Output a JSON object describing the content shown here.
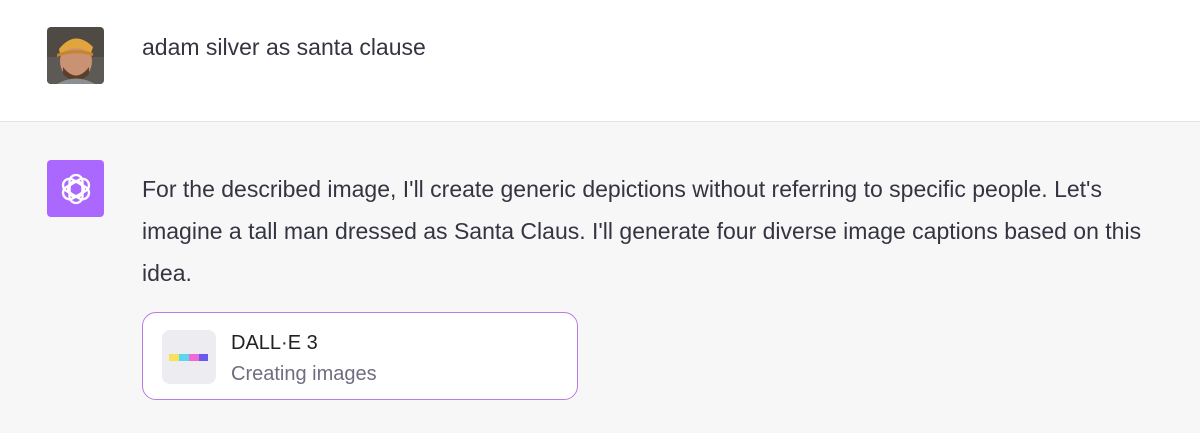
{
  "user_message": {
    "text": "adam silver as santa clause"
  },
  "assistant_message": {
    "text": "For the described image, I'll create generic depictions without referring to specific people. Let's imagine a tall man dressed as Santa Claus. I'll generate four diverse image captions based on this idea.",
    "avatar_icon": "openai-logo-icon",
    "avatar_color": "#ab68ff"
  },
  "tool_card": {
    "name": "DALL·E 3",
    "status": "Creating images",
    "icon": "dalle-loading-icon",
    "border_color": "#b57ee6",
    "loading_colors": [
      "#f7e15a",
      "#5ad6f0",
      "#f06ad6",
      "#6a5af0"
    ]
  }
}
